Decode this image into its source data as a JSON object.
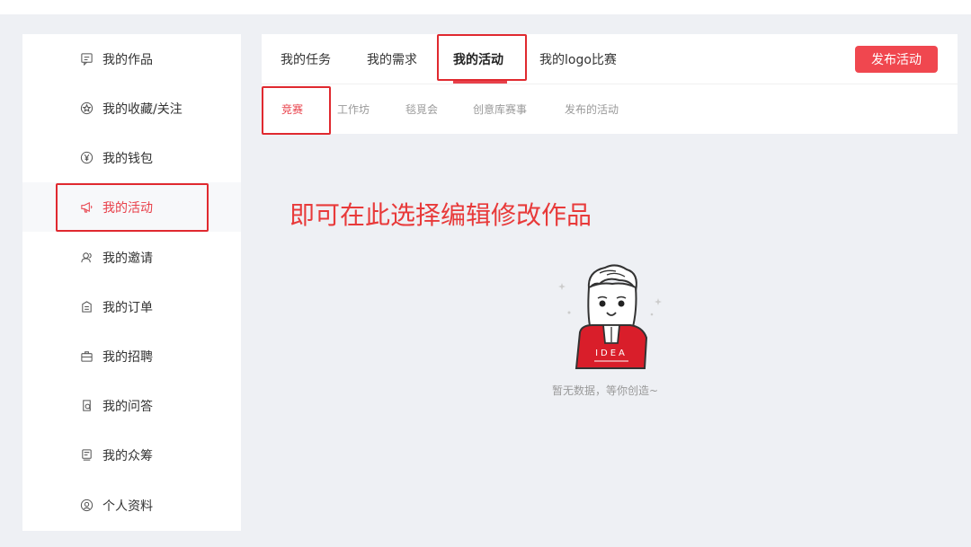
{
  "sidebar": {
    "items": [
      {
        "label": "我的作品",
        "icon": "file-icon"
      },
      {
        "label": "我的收藏/关注",
        "icon": "star-icon"
      },
      {
        "label": "我的钱包",
        "icon": "yen-icon"
      },
      {
        "label": "我的活动",
        "icon": "megaphone-icon",
        "active": true
      },
      {
        "label": "我的邀请",
        "icon": "users-icon"
      },
      {
        "label": "我的订单",
        "icon": "order-icon"
      },
      {
        "label": "我的招聘",
        "icon": "briefcase-icon"
      },
      {
        "label": "我的问答",
        "icon": "qa-icon"
      },
      {
        "label": "我的众筹",
        "icon": "crowdfund-icon"
      },
      {
        "label": "个人资料",
        "icon": "profile-icon"
      }
    ]
  },
  "tabs": [
    {
      "label": "我的任务"
    },
    {
      "label": "我的需求"
    },
    {
      "label": "我的活动",
      "active": true
    },
    {
      "label": "我的logo比赛"
    }
  ],
  "publish_button": "发布活动",
  "subtabs": [
    {
      "label": "竞赛",
      "active": true
    },
    {
      "label": "工作坊"
    },
    {
      "label": "毯覓会"
    },
    {
      "label": "创意库赛事"
    },
    {
      "label": "发布的活动"
    }
  ],
  "annotation": "即可在此选择编辑修改作品",
  "empty_state": {
    "text": "暂无数据，等你创造~",
    "shirt_text": "IDEA"
  },
  "colors": {
    "accent": "#e8404a",
    "highlight_box": "#e0292f",
    "background": "#eef0f4"
  }
}
